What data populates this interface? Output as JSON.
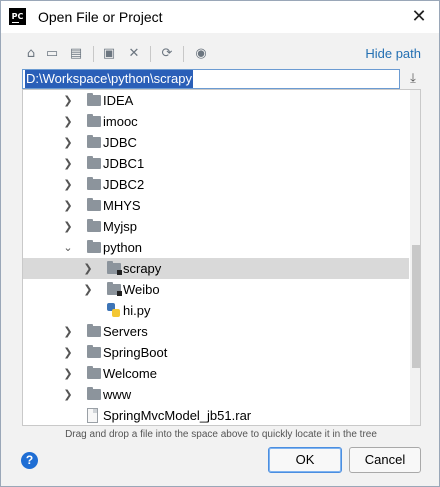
{
  "window": {
    "title": "Open File or Project",
    "app_icon_text": "PC",
    "close_glyph": "✕"
  },
  "toolbar": {
    "icons": [
      "home-icon",
      "desktop-icon",
      "project-icon",
      "new-folder-icon",
      "delete-icon",
      "refresh-icon",
      "show-hidden-icon"
    ],
    "glyphs": [
      "⌂",
      "▭",
      "▤",
      "▣",
      "✕",
      "⟳",
      "◉"
    ],
    "hide_path_label": "Hide path"
  },
  "path": {
    "value": "D:\\Workspace\\python\\scrapy",
    "download_glyph": "⤓"
  },
  "tree": {
    "items": [
      {
        "label": "IDEA",
        "type": "folder",
        "level": 0,
        "expanded": false
      },
      {
        "label": "imooc",
        "type": "folder",
        "level": 0,
        "expanded": false
      },
      {
        "label": "JDBC",
        "type": "folder",
        "level": 0,
        "expanded": false
      },
      {
        "label": "JDBC1",
        "type": "folder",
        "level": 0,
        "expanded": false
      },
      {
        "label": "JDBC2",
        "type": "folder",
        "level": 0,
        "expanded": false
      },
      {
        "label": "MHYS",
        "type": "folder",
        "level": 0,
        "expanded": false
      },
      {
        "label": "Myjsp",
        "type": "folder",
        "level": 0,
        "expanded": false
      },
      {
        "label": "python",
        "type": "folder",
        "level": 0,
        "expanded": true
      },
      {
        "label": "scrapy",
        "type": "module-folder",
        "level": 1,
        "expanded": false,
        "selected": true
      },
      {
        "label": "Weibo",
        "type": "module-folder",
        "level": 1,
        "expanded": false
      },
      {
        "label": "hi.py",
        "type": "python-file",
        "level": 1
      },
      {
        "label": "Servers",
        "type": "folder",
        "level": 0,
        "expanded": false
      },
      {
        "label": "SpringBoot",
        "type": "folder",
        "level": 0,
        "expanded": false
      },
      {
        "label": "Welcome",
        "type": "folder",
        "level": 0,
        "expanded": false
      },
      {
        "label": "www",
        "type": "folder",
        "level": 0,
        "expanded": false
      },
      {
        "label": "SpringMvcModel_jb51.rar",
        "type": "rar-file",
        "level": 0
      }
    ],
    "collapsed_glyph": "❯",
    "expanded_glyph": "⌄"
  },
  "hint": "Drag and drop a file into the space above to quickly locate it in the tree",
  "buttons": {
    "help_label": "?",
    "ok_label": "OK",
    "cancel_label": "Cancel"
  }
}
